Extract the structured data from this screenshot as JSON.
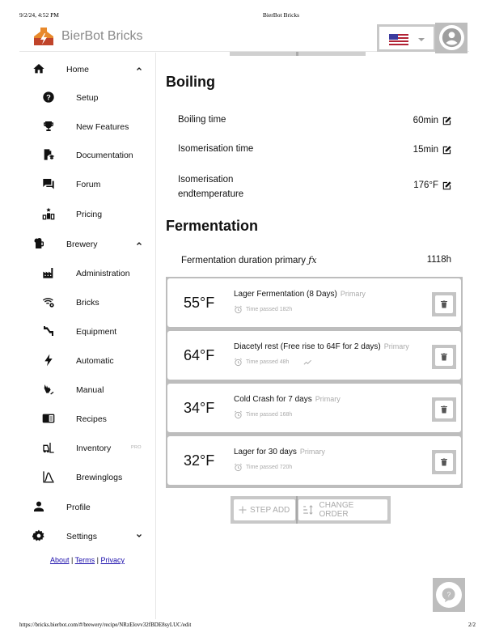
{
  "print": {
    "datetime": "9/2/24, 4:52 PM",
    "doc_title": "BierBot Bricks",
    "url": "https://bricks.bierbot.com/#/brewery/recipe/NRzElovv32fBDE8syLUC/edit",
    "page": "2/2"
  },
  "appbar": {
    "brand": "BierBot Bricks",
    "language": "en-US",
    "flag_icon": "us-flag-icon",
    "account_icon": "account-circle-icon"
  },
  "sidebar": {
    "home": {
      "label": "Home",
      "icon": "home-icon",
      "expanded": true
    },
    "home_items": [
      {
        "label": "Setup",
        "icon": "help-circle-icon"
      },
      {
        "label": "New Features",
        "icon": "trophy-icon"
      },
      {
        "label": "Documentation",
        "icon": "book-education-icon"
      },
      {
        "label": "Forum",
        "icon": "forum-icon"
      },
      {
        "label": "Pricing",
        "icon": "podium-icon"
      }
    ],
    "brewery": {
      "label": "Brewery",
      "icon": "beer-mug-icon",
      "expanded": true
    },
    "brewery_items": [
      {
        "label": "Administration",
        "icon": "factory-icon"
      },
      {
        "label": "Bricks",
        "icon": "wifi-cog-icon"
      },
      {
        "label": "Equipment",
        "icon": "pipe-icon"
      },
      {
        "label": "Automatic",
        "icon": "lightning-icon"
      },
      {
        "label": "Manual",
        "icon": "hand-pointer-icon"
      },
      {
        "label": "Recipes",
        "icon": "recipe-book-icon"
      },
      {
        "label": "Inventory",
        "icon": "forklift-icon",
        "badge": "PRO"
      },
      {
        "label": "Brewinglogs",
        "icon": "chart-bell-curve-icon"
      }
    ],
    "profile": {
      "label": "Profile",
      "icon": "account-icon"
    },
    "settings": {
      "label": "Settings",
      "icon": "cog-icon",
      "expanded": false
    },
    "legal": {
      "about": "About",
      "terms": "Terms",
      "privacy": "Privacy",
      "separator": " | "
    }
  },
  "boiling": {
    "title": "Boiling",
    "rows": [
      {
        "label": "Boiling time",
        "value": "60min"
      },
      {
        "label": "Isomerisation time",
        "value": "15min"
      },
      {
        "label_line1": "Isomerisation",
        "label_line2": "endtemperature",
        "value": "176°F"
      }
    ]
  },
  "fermentation": {
    "title": "Fermentation",
    "duration_label": "Fermentation duration primary",
    "duration_fx": "ƒx",
    "duration_value": "1118h",
    "steps": [
      {
        "temp": "55°F",
        "name": "Lager Fermentation (8 Days)",
        "phase": "Primary",
        "time_passed": "Time passed 182h",
        "ramp": false
      },
      {
        "temp": "64°F",
        "name": "Diacetyl rest (Free rise to 64F for 2 days)",
        "phase": "Primary",
        "time_passed": "Time passed 48h",
        "ramp": true
      },
      {
        "temp": "34°F",
        "name": "Cold Crash for 7 days",
        "phase": "Primary",
        "time_passed": "Time passed 168h",
        "ramp": false
      },
      {
        "temp": "32°F",
        "name": "Lager for 30 days",
        "phase": "Primary",
        "time_passed": "Time passed 720h",
        "ramp": false
      }
    ],
    "buttons": {
      "step_add": "STEP ADD",
      "change_order": "CHANGE ORDER"
    }
  },
  "colors": {
    "brand_text": "#8a8a8a",
    "muted": "#aaaaaa",
    "logo_orange": "#e8892b",
    "logo_red": "#c0442a",
    "link": "#1a0dab"
  }
}
